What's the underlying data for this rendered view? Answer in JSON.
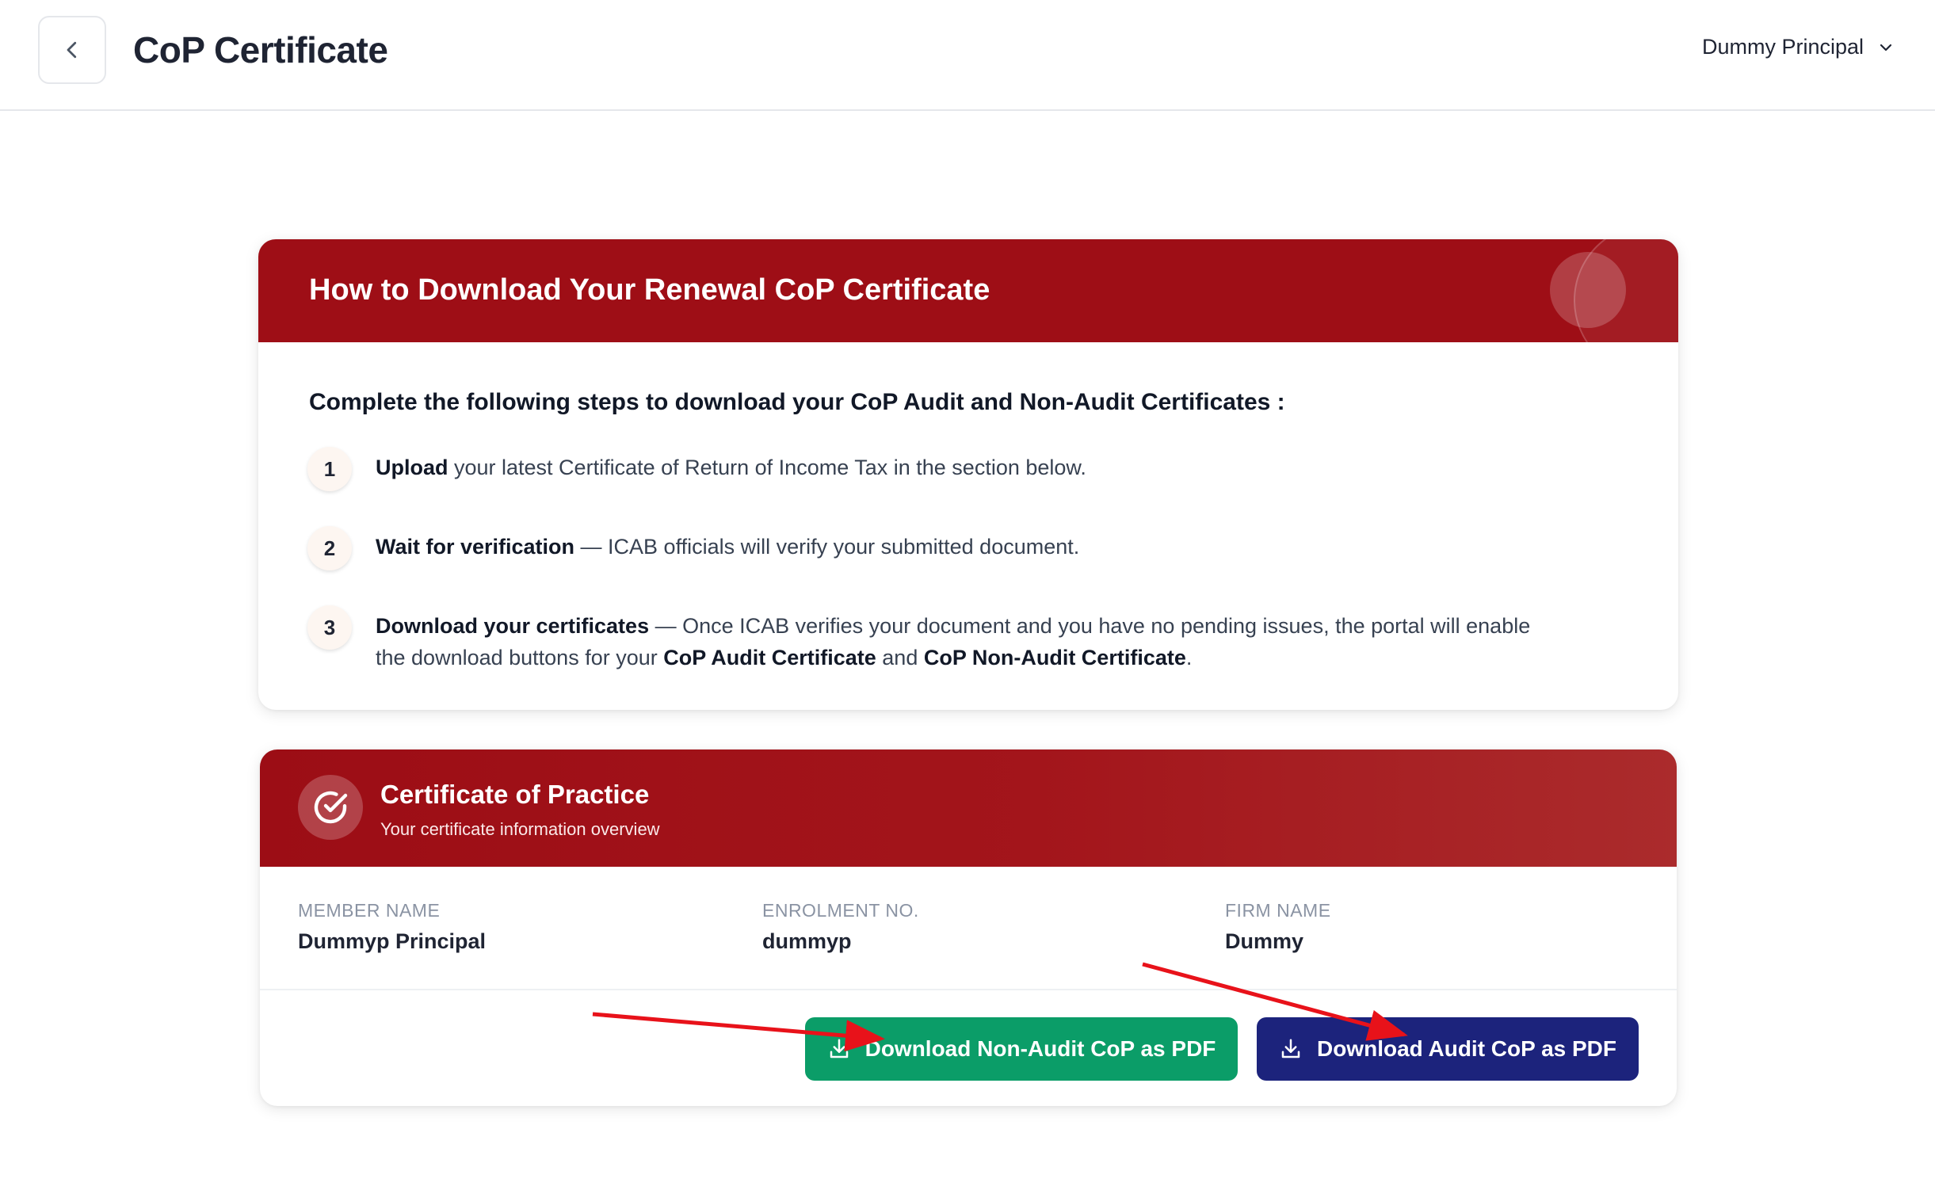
{
  "header": {
    "title": "CoP Certificate",
    "user_name": "Dummy Principal",
    "back_icon": "chevron-left-icon",
    "dropdown_icon": "chevron-down-icon"
  },
  "instructions": {
    "title": "How to Download Your Renewal CoP Certificate",
    "intro": "Complete the following steps to download your CoP Audit and Non-Audit Certificates :",
    "steps": [
      {
        "number": "1",
        "strong": "Upload",
        "text": " your latest Certificate of Return of Income Tax in the section below."
      },
      {
        "number": "2",
        "strong": "Wait for verification",
        "text": " — ICAB officials will verify your submitted document."
      },
      {
        "number": "3",
        "strong": "Download your certificates",
        "text": " — Once ICAB verifies your document and you have no pending issues, the portal will enable the download buttons for your ",
        "strong2": "CoP Audit Certificate",
        "text2": " and ",
        "strong3": "CoP Non-Audit Certificate",
        "text3": "."
      }
    ]
  },
  "certificate": {
    "title": "Certificate of Practice",
    "subtitle": "Your certificate information overview",
    "icon": "check-circle-icon",
    "fields": [
      {
        "label": "MEMBER NAME",
        "value": "Dummyp Principal"
      },
      {
        "label": "ENROLMENT NO.",
        "value": "dummyp"
      },
      {
        "label": "FIRM NAME",
        "value": "Dummy"
      }
    ],
    "buttons": {
      "non_audit_label": "Download Non-Audit CoP as PDF",
      "audit_label": "Download Audit CoP as PDF",
      "icon": "download-icon"
    }
  },
  "colors": {
    "header_red": "#9e0e16",
    "non_audit_green": "#0b9d68",
    "audit_navy": "#1c237c",
    "annotation_arrow": "#e8121a"
  }
}
